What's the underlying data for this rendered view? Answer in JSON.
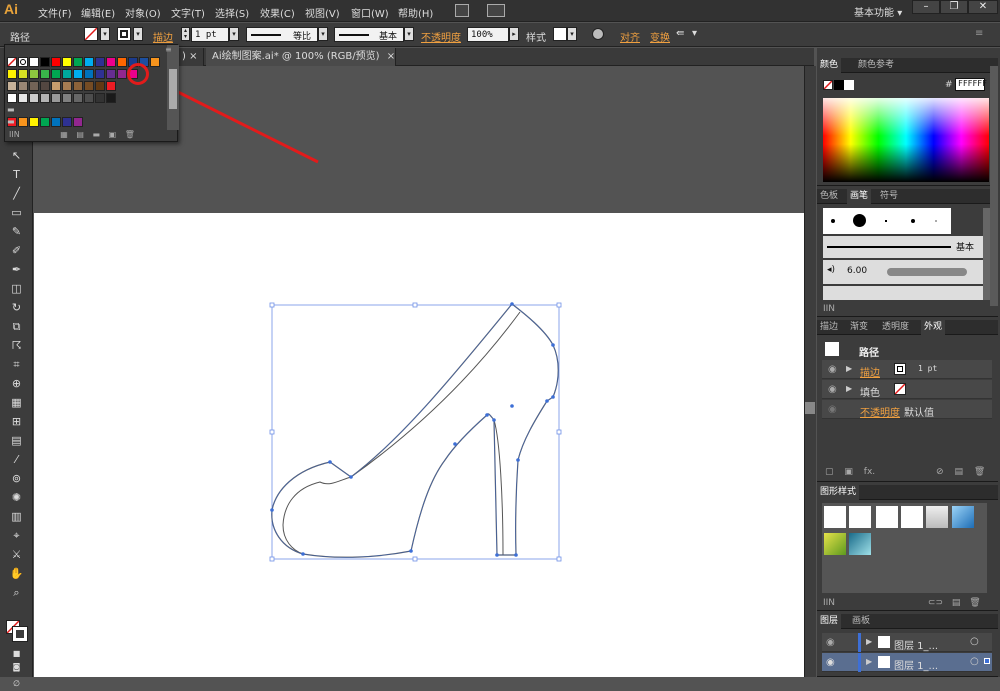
{
  "app": {
    "logo": "Ai"
  },
  "menu": [
    "文件(F)",
    "编辑(E)",
    "对象(O)",
    "文字(T)",
    "选择(S)",
    "效果(C)",
    "视图(V)",
    "窗口(W)",
    "帮助(H)"
  ],
  "workspace": {
    "label": "基本功能",
    "arrow": "▾"
  },
  "window_controls": [
    "–",
    "❐",
    "✕"
  ],
  "control_bar": {
    "object_type": "路径",
    "stroke_label": "描边",
    "stroke_weight": "1 pt",
    "profile_label": "等比",
    "brush_label": "基本",
    "opacity_label": "不透明度",
    "opacity_value": "100%",
    "style_label": "样式",
    "align_label": "对齐",
    "transform_label": "变换"
  },
  "document_tabs": [
    {
      "title": ")",
      "close": "×"
    },
    {
      "title": "Ai绘制图案.ai* @ 100% (RGB/预览)",
      "close": "×"
    }
  ],
  "swatches": {
    "row1": [
      "#ffffff",
      "#000000",
      "#ff0000",
      "#ffff00",
      "#00a651",
      "#00aeef",
      "#2e3192",
      "#ec008c",
      "#ff6600",
      "#1b3a8c",
      "#1c4fa0",
      "#f7941d"
    ],
    "row2": [
      "#fff200",
      "#d7df23",
      "#8dc63f",
      "#39b54a",
      "#00a651",
      "#00a99d",
      "#00aeef",
      "#0072bc",
      "#2e3192",
      "#662d91",
      "#92278f",
      "#ec008c"
    ],
    "row3": [
      "#c7b299",
      "#998675",
      "#736357",
      "#534741",
      "#c69c6d",
      "#a67c52",
      "#8c6239",
      "#754c24",
      "#603913",
      "#ed1c24"
    ],
    "row4": [
      "#ffffff",
      "#e6e6e6",
      "#cccccc",
      "#b3b3b3",
      "#999999",
      "#808080",
      "#666666",
      "#4d4d4d",
      "#333333",
      "#1a1a1a"
    ],
    "row5": [
      "#ed1c24",
      "#f7941d",
      "#fff200",
      "#00a651",
      "#0072bc",
      "#2e3192",
      "#92278f"
    ],
    "footer_icons": [
      "swatch-libraries-icon",
      "show-kinds-icon",
      "swatch-options-icon",
      "new-group-icon",
      "new-swatch-icon",
      "delete-icon"
    ]
  },
  "colors": {
    "accent_red": "#e21b1b",
    "path_blue": "#3d6fd6",
    "highlight_orange": "#f0a040"
  },
  "color_panel": {
    "tabs": [
      "颜色",
      "颜色参考"
    ],
    "hex_label": "#",
    "hex_value": "FFFFFF"
  },
  "brush_panel": {
    "tabs": [
      "色板",
      "画笔",
      "符号"
    ],
    "basic_label": "基本",
    "size_value": "6.00"
  },
  "appearance_panel": {
    "tabs": [
      "描边",
      "渐变",
      "透明度",
      "外观"
    ],
    "title": "路径",
    "rows": [
      {
        "label": "描边",
        "value": "1 pt"
      },
      {
        "label": "填色",
        "value": ""
      },
      {
        "label": "不透明度",
        "value": "默认值"
      }
    ]
  },
  "graphic_styles": {
    "tabs": [
      "图形样式"
    ]
  },
  "layers_panel": {
    "tabs": [
      "图层",
      "画板"
    ],
    "layers": [
      {
        "name": "图层 1_..."
      },
      {
        "name": "图层 1_..."
      }
    ]
  }
}
